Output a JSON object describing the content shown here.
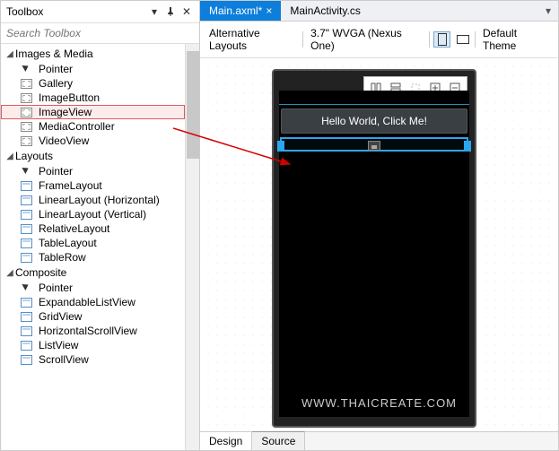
{
  "toolbox": {
    "title": "Toolbox",
    "searchPlaceholder": "Search Toolbox",
    "categories": [
      {
        "name": "Images & Media",
        "items": [
          "Pointer",
          "Gallery",
          "ImageButton",
          "ImageView",
          "MediaController",
          "VideoView"
        ]
      },
      {
        "name": "Layouts",
        "items": [
          "Pointer",
          "FrameLayout",
          "LinearLayout (Horizontal)",
          "LinearLayout (Vertical)",
          "RelativeLayout",
          "TableLayout",
          "TableRow"
        ]
      },
      {
        "name": "Composite",
        "items": [
          "Pointer",
          "ExpandableListView",
          "GridView",
          "HorizontalScrollView",
          "ListView",
          "ScrollView"
        ]
      }
    ],
    "selected": "ImageView"
  },
  "tabs": {
    "active": "Main.axml*",
    "inactive": "MainActivity.cs"
  },
  "designerOptions": {
    "altLayouts": "Alternative Layouts",
    "device": "3.7\" WVGA (Nexus One)",
    "theme": "Default Theme"
  },
  "preview": {
    "buttonText": "Hello World, Click Me!"
  },
  "bottomTabs": {
    "design": "Design",
    "source": "Source"
  },
  "watermark": "WWW.THAICREATE.COM"
}
